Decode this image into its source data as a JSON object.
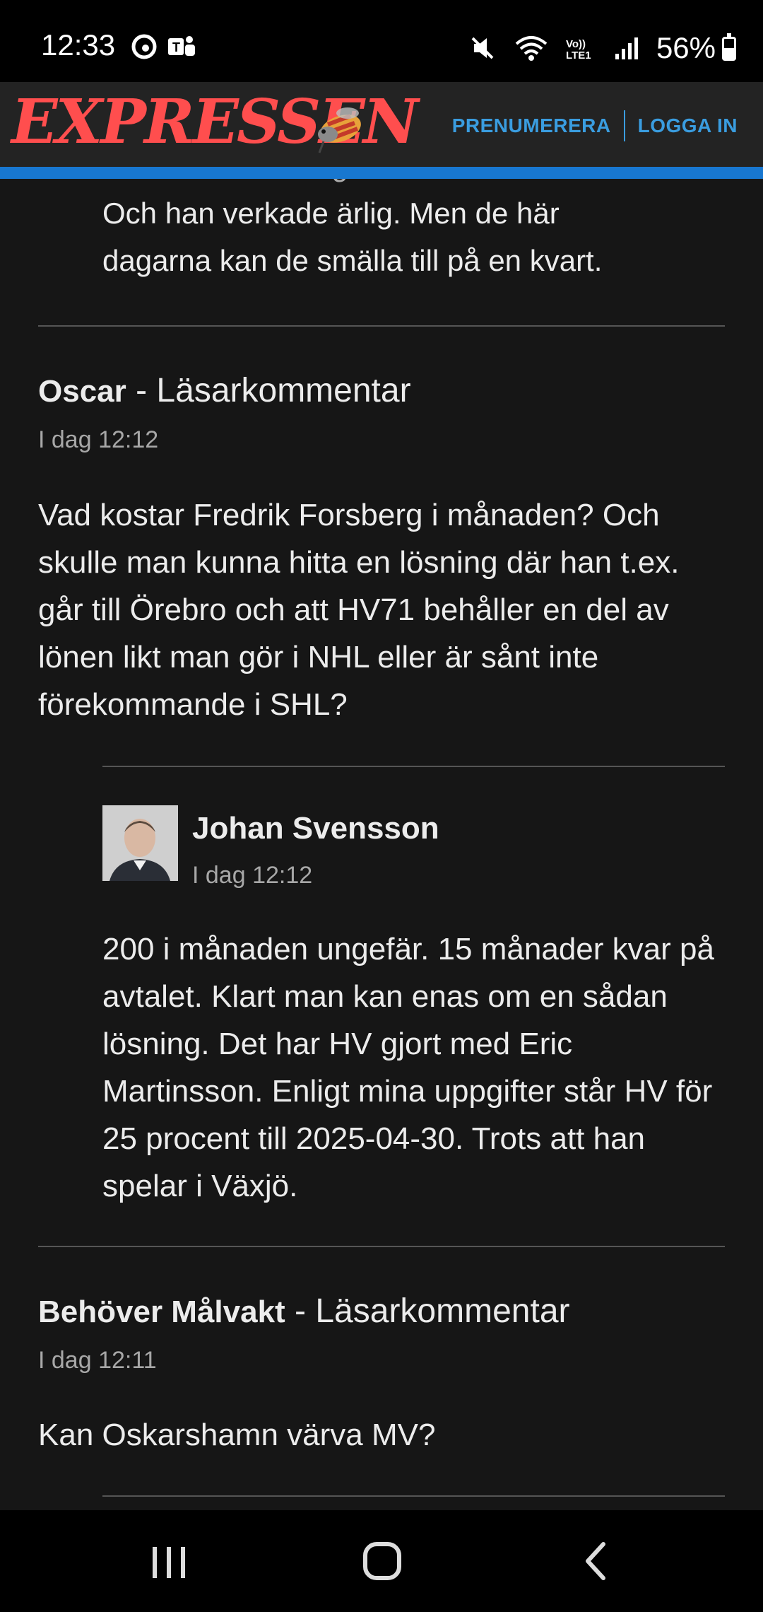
{
  "status": {
    "time": "12:33",
    "battery": "56%",
    "icons": [
      "edge-icon",
      "teams-icon",
      "mute-icon",
      "wifi-icon",
      "volte-icon",
      "signal-icon",
      "battery-icon"
    ],
    "volte_label": "Vo)) LTE1"
  },
  "header": {
    "logo": "EXPRESSEN",
    "subscribe": "PRENUMERERA",
    "login": "LOGGA IN",
    "logo_color": "#ff4e4e",
    "link_color": "#3a9de0",
    "bar_color": "#1877d0"
  },
  "previous_reply": {
    "line_1": "Kanske kommer igen Låt inte Storkkel ta.",
    "line_2": "Och han verkade ärlig. Men de här",
    "line_3": "dagarna kan de smälla till på en kvart."
  },
  "comments": [
    {
      "author": "Oscar",
      "separator": " - ",
      "kind": "Läsarkommentar",
      "time": "I dag 12:12",
      "body": "Vad kostar Fredrik Forsberg i månaden? Och skulle man kunna hitta en lösning där han t.ex. går till Örebro och att HV71 behåller en del av lönen likt man gör i NHL eller är sånt inte förekommande i SHL?",
      "reply": {
        "author": "Johan Svensson",
        "time": "I dag 12:12",
        "body": "200 i månaden ungefär. 15 månader kvar på avtalet. Klart man kan enas om en sådan lösning. Det har HV gjort med Eric Martinsson. Enligt mina uppgifter står HV för 25 procent till 2025-04-30. Trots att han spelar i Växjö."
      }
    },
    {
      "author": "Behöver Målvakt",
      "separator": " - ",
      "kind": "Läsarkommentar",
      "time": "I dag 12:11",
      "body": "Kan Oskarshamn värva MV?"
    }
  ],
  "nav": {
    "recents": "recents-icon",
    "home": "home-icon",
    "back": "back-icon"
  }
}
